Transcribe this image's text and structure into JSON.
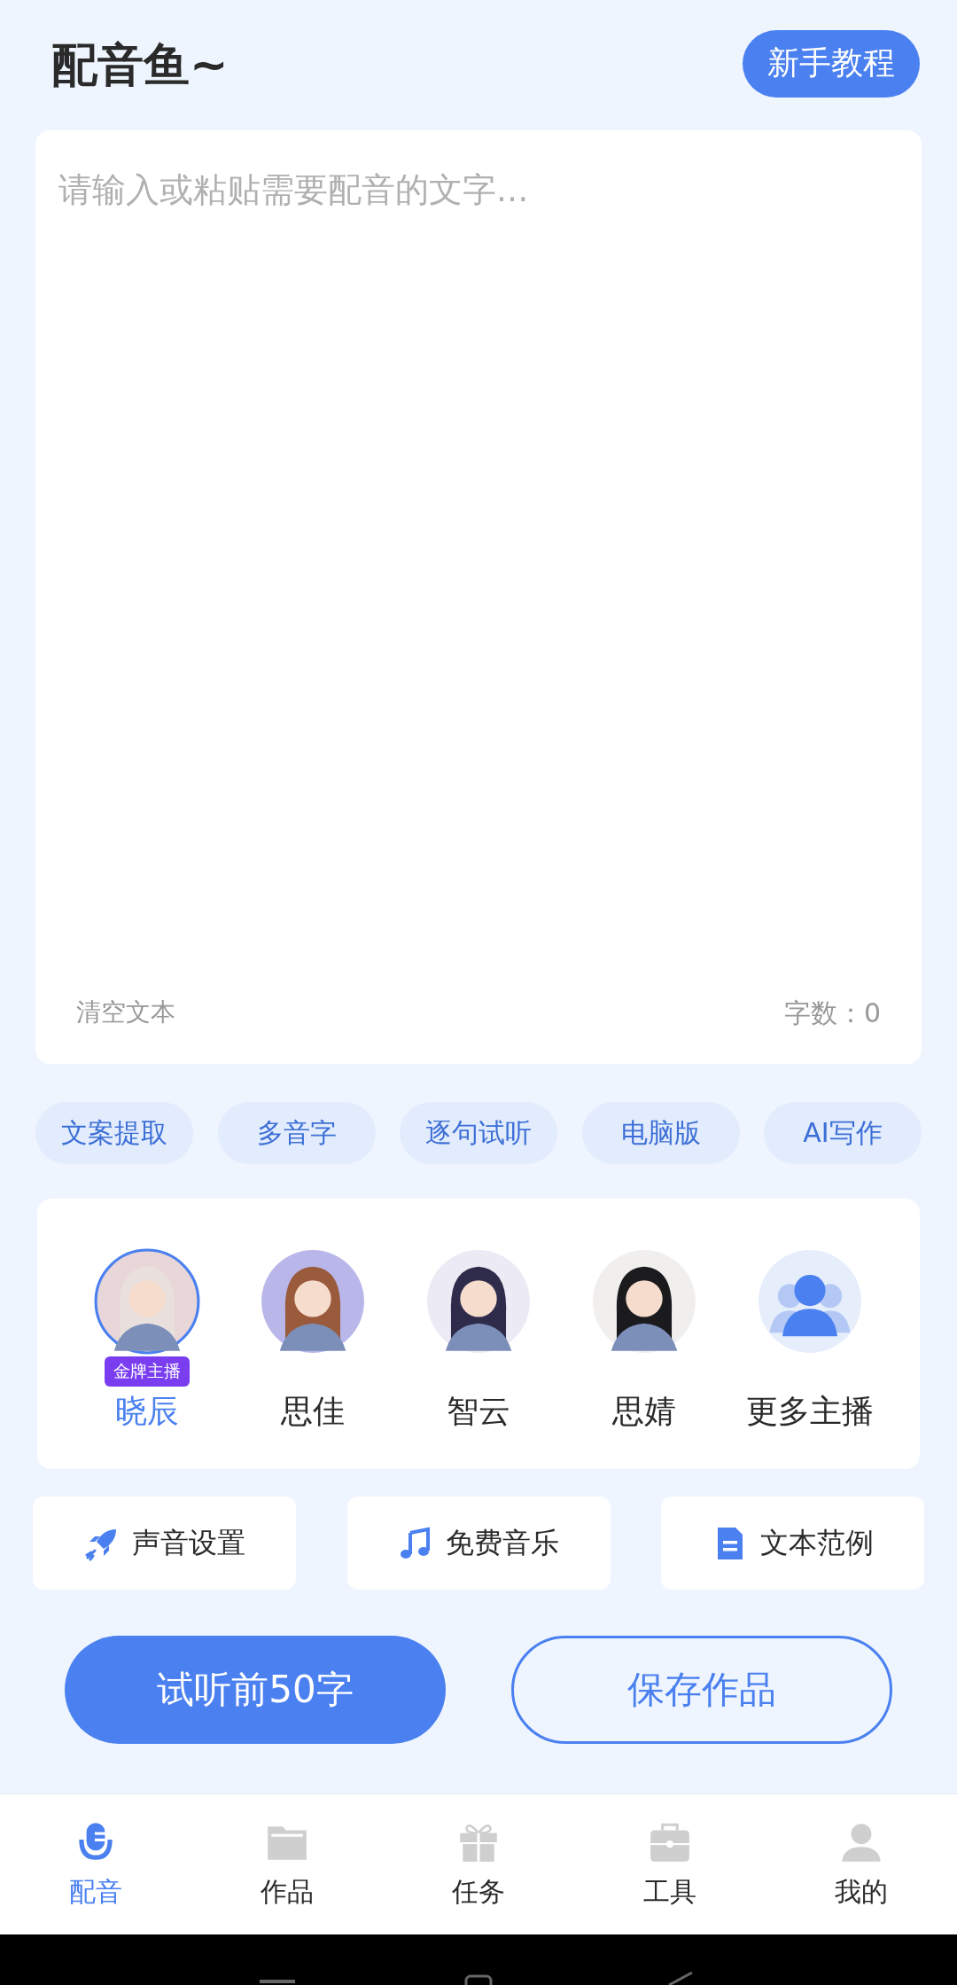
{
  "header": {
    "title": "配音鱼~",
    "tutorial_button": "新手教程"
  },
  "editor": {
    "placeholder": "请输入或粘贴需要配音的文字...",
    "clear_label": "清空文本",
    "count_label": "字数：0"
  },
  "quick_chips": [
    "文案提取",
    "多音字",
    "逐句试听",
    "电脑版",
    "AI写作"
  ],
  "voices": [
    {
      "name": "晓辰",
      "selected": true,
      "badge": "金牌主播",
      "kind": "avatar",
      "color": "#e8d6d8"
    },
    {
      "name": "思佳",
      "selected": false,
      "kind": "avatar",
      "color": "#b9b6ea"
    },
    {
      "name": "智云",
      "selected": false,
      "kind": "avatar",
      "color": "#eceaf4"
    },
    {
      "name": "思婧",
      "selected": false,
      "kind": "avatar",
      "color": "#f1eeee"
    },
    {
      "name": "更多主播",
      "selected": false,
      "kind": "more"
    }
  ],
  "tools": [
    {
      "label": "声音设置",
      "kind": "rocket"
    },
    {
      "label": "免费音乐",
      "kind": "music"
    },
    {
      "label": "文本范例",
      "kind": "document"
    }
  ],
  "actions": {
    "preview": "试听前50字",
    "save": "保存作品"
  },
  "nav": [
    {
      "label": "配音",
      "selected": true,
      "kind": "mic"
    },
    {
      "label": "作品",
      "selected": false,
      "kind": "folder"
    },
    {
      "label": "任务",
      "selected": false,
      "kind": "gift"
    },
    {
      "label": "工具",
      "selected": false,
      "kind": "toolbox"
    },
    {
      "label": "我的",
      "selected": false,
      "kind": "person"
    }
  ]
}
